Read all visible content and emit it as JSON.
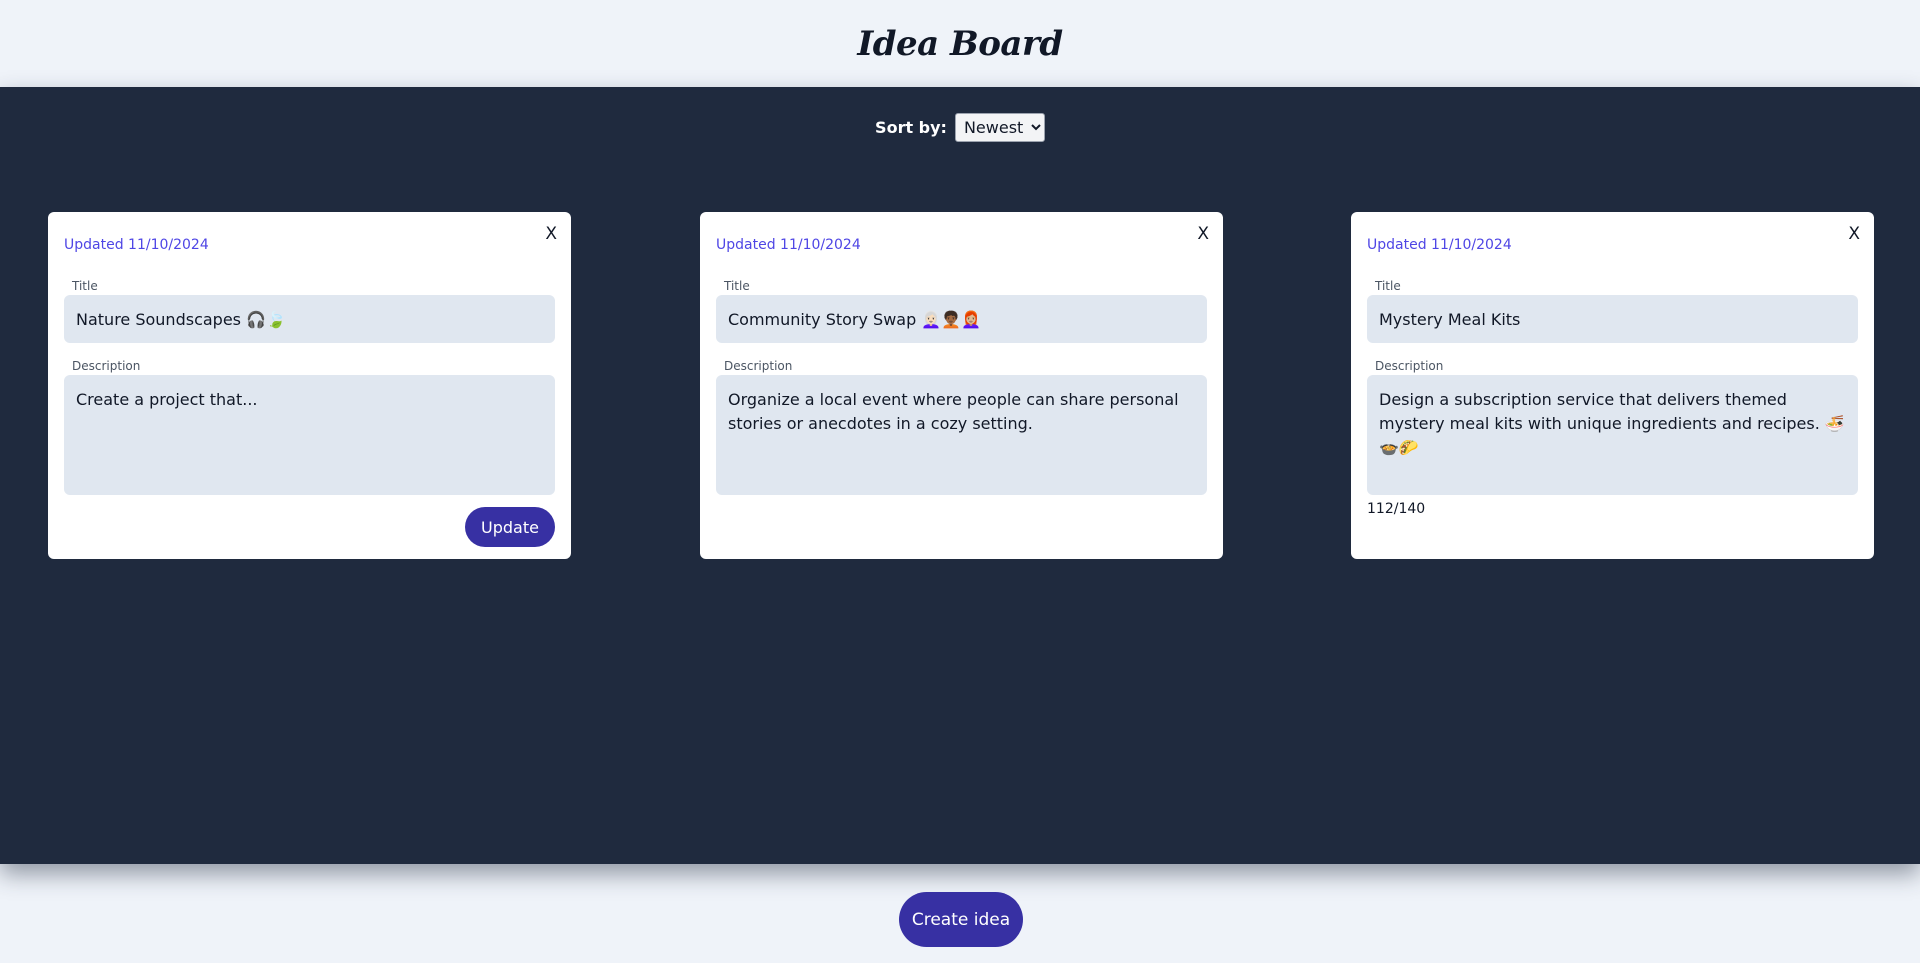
{
  "header": {
    "title": "Idea Board"
  },
  "sort": {
    "label": "Sort by:",
    "selected": "Newest"
  },
  "cards": [
    {
      "updated": "Updated 11/10/2024",
      "close_label": "X",
      "title_label": "Title",
      "title_value": "Nature Soundscapes 🎧🍃",
      "description_label": "Description",
      "description_value": "Create a project that...",
      "update_label": "Update"
    },
    {
      "updated": "Updated 11/10/2024",
      "close_label": "X",
      "title_label": "Title",
      "title_value": "Community Story Swap 👩🏻‍🦳🧑🏾‍🦱👩🏼‍🦰",
      "description_label": "Description",
      "description_value": "Organize a local event where people can share personal stories or anecdotes in a cozy setting."
    },
    {
      "updated": "Updated 11/10/2024",
      "close_label": "X",
      "title_label": "Title",
      "title_value": "Mystery Meal Kits",
      "description_label": "Description",
      "description_value": "Design a subscription service that delivers themed mystery meal kits with unique ingredients and recipes. 🍜🍲🌮",
      "char_count": "112/140"
    }
  ],
  "footer": {
    "create_label": "Create idea"
  },
  "colors": {
    "accent": "#3730a3",
    "updated_text": "#4f46e5",
    "board_bg": "#1f2a3e",
    "page_bg": "#eff3f9",
    "input_bg": "#e0e7f0"
  }
}
